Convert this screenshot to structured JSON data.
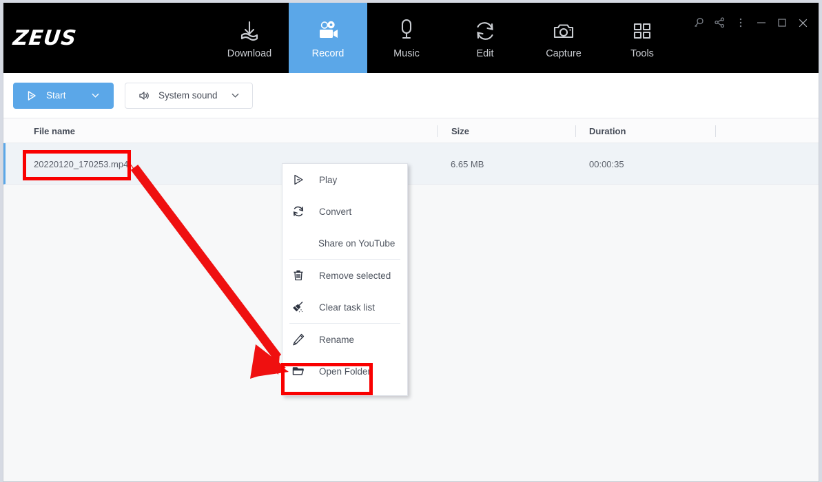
{
  "window": {
    "logo": "ZEUS",
    "controls": [
      {
        "name": "search-icon",
        "label": "Search"
      },
      {
        "name": "share-icon",
        "label": "Share"
      },
      {
        "name": "more-menu-icon",
        "label": "More"
      },
      {
        "name": "minimize-icon",
        "label": "Minimize"
      },
      {
        "name": "maximize-icon",
        "label": "Maximize"
      },
      {
        "name": "close-icon",
        "label": "Close"
      }
    ]
  },
  "nav": {
    "active": "Record",
    "tabs": [
      {
        "label": "Download",
        "icon": "download-icon"
      },
      {
        "label": "Record",
        "icon": "video-camera-icon"
      },
      {
        "label": "Music",
        "icon": "microphone-icon"
      },
      {
        "label": "Edit",
        "icon": "convert-arrows-icon"
      },
      {
        "label": "Capture",
        "icon": "camera-icon"
      },
      {
        "label": "Tools",
        "icon": "grid-squares-icon"
      }
    ]
  },
  "toolbar": {
    "start_label": "Start",
    "start_icon": "play-icon",
    "start_chevron": "chevron-down-icon",
    "sound_label": "System sound",
    "sound_icon": "speaker-icon",
    "sound_chevron": "chevron-down-icon"
  },
  "table": {
    "columns": [
      "File name",
      "Size",
      "Duration",
      ""
    ],
    "rows": [
      {
        "filename": "20220120_170253.mp4",
        "size": "6.65 MB",
        "duration": "00:00:35"
      }
    ]
  },
  "context_menu": {
    "items": [
      {
        "label": "Play",
        "icon": "play-outline-icon"
      },
      {
        "label": "Convert",
        "icon": "convert-circular-icon"
      },
      {
        "label": "Share on YouTube",
        "icon": ""
      },
      {
        "label": "Remove selected",
        "icon": "trash-icon"
      },
      {
        "label": "Clear task list",
        "icon": "broom-icon"
      },
      {
        "label": "Rename",
        "icon": "pencil-icon"
      },
      {
        "label": "Open Folder",
        "icon": "folder-icon"
      }
    ]
  },
  "annotations": {
    "highlight_color": "#f90000",
    "arrow_color": "#ef1010",
    "boxes": [
      "filename-cell",
      "open-folder-menu-item"
    ],
    "arrow": "from-filename-to-open-folder"
  },
  "colors": {
    "accent": "#5ba7e8",
    "titlebar": "#000000",
    "row_selected": "#eff3f7",
    "text": "#4e545f"
  }
}
